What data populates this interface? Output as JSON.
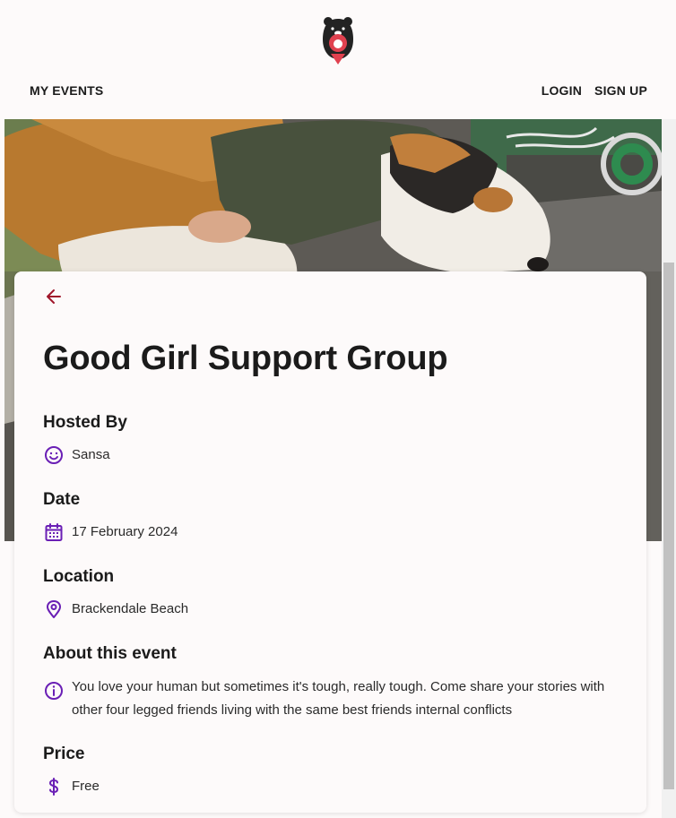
{
  "header": {
    "logo_icon": "bear-logo-icon",
    "nav_left": "MY EVENTS",
    "login": "LOGIN",
    "signup": "SIGN UP"
  },
  "event": {
    "title": "Good Girl Support Group",
    "hosted_by": {
      "heading": "Hosted By",
      "value": "Sansa",
      "icon": "smiley-icon"
    },
    "date": {
      "heading": "Date",
      "value": "17 February 2024",
      "icon": "calendar-icon"
    },
    "location": {
      "heading": "Location",
      "value": "Brackendale Beach",
      "icon": "location-pin-icon"
    },
    "about": {
      "heading": "About this event",
      "value": "You love your human but sometimes it's tough, really tough. Come share your stories with other four legged friends living with the same best friends internal conflicts",
      "icon": "info-icon"
    },
    "price": {
      "heading": "Price",
      "value": "Free",
      "icon": "dollar-icon"
    }
  },
  "colors": {
    "accent_icon": "#6a1fb5",
    "back_arrow": "#a0152a",
    "background": "#fdfafa"
  }
}
